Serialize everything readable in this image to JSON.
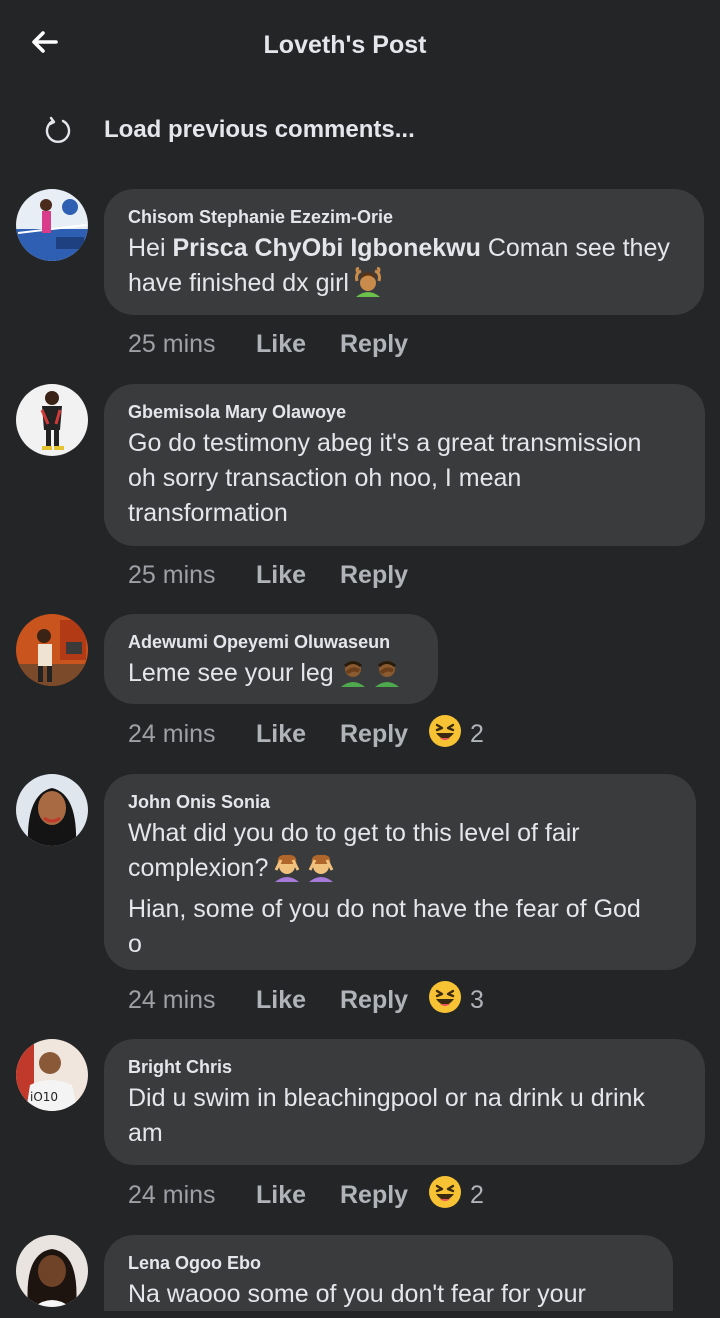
{
  "header": {
    "title": "Loveth's Post",
    "back_icon": "arrow-left-icon"
  },
  "load_previous": {
    "label": "Load previous comments...",
    "icon": "refresh-icon"
  },
  "comments": [
    {
      "author": "Chisom Stephanie Ezezim-Orie",
      "text_prefix": "Hei ",
      "mention": "Prisca ChyObi Igbonekwu",
      "text_suffix": " Coman see they\nhave finished dx girl",
      "emoji": "person-gesturing-ok-emoji",
      "time": "25 mins",
      "like": "Like",
      "reply": "Reply"
    },
    {
      "author": "Gbemisola Mary Olawoye",
      "text": "Go do testimony abeg it's a great transmission\noh sorry transaction oh noo, I mean\ntransformation",
      "time": "25 mins",
      "like": "Like",
      "reply": "Reply"
    },
    {
      "author": "Adewumi Opeyemi Oluwaseun",
      "text": "Leme see your leg",
      "emoji": "person-facepalming-emoji",
      "time": "24 mins",
      "like": "Like",
      "reply": "Reply",
      "reaction": "laughing-reaction",
      "reaction_count": "2"
    },
    {
      "author": "John Onis Sonia",
      "text": "What did you do to get to this level of fair\ncomplexion?",
      "text2": "Hian, some of you do not have the fear of God\no",
      "emoji": "person-gesturing-no-emoji",
      "time": "24 mins",
      "like": "Like",
      "reply": "Reply",
      "reaction": "laughing-reaction",
      "reaction_count": "3"
    },
    {
      "author": "Bright Chris",
      "text": "Did u swim in bleachingpool or na drink u drink\nam",
      "time": "24 mins",
      "like": "Like",
      "reply": "Reply",
      "reaction": "laughing-reaction",
      "reaction_count": "2"
    },
    {
      "author": "Lena Ogoo Ebo",
      "text": "Na waooo some of you don't fear for your"
    }
  ],
  "colors": {
    "background": "#242527",
    "bubble": "#3a3b3c",
    "text": "#e4e6eb",
    "secondary": "#b0b3b8"
  }
}
